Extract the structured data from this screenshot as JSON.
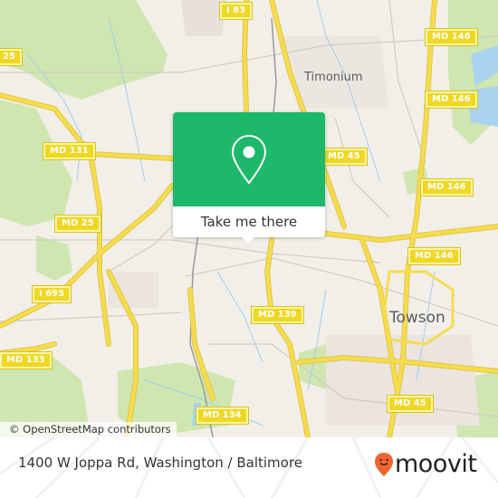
{
  "map": {
    "colors": {
      "land": "#f2efe9",
      "park": "#cfe6b0",
      "residential": "#e7e0db",
      "water": "#a9d3ee",
      "highway": "#f5dc4e",
      "highway_casing": "#e2c744",
      "minor_road": "#cfcac4",
      "rail": "#9a9a9a"
    },
    "shields": [
      {
        "label": "I 83"
      },
      {
        "label": "MD 146"
      },
      {
        "label": "MD 146"
      },
      {
        "label": "MD 131"
      },
      {
        "label": "MD 45"
      },
      {
        "label": "MD 146"
      },
      {
        "label": "MD 25"
      },
      {
        "label": "MD 146"
      },
      {
        "label": "I 695"
      },
      {
        "label": "MD 139"
      },
      {
        "label": "MD 133"
      },
      {
        "label": "MD 45"
      },
      {
        "label": "MD 134"
      },
      {
        "label": "25"
      }
    ],
    "places": [
      {
        "label": "Timonium"
      },
      {
        "label": "Towson"
      }
    ],
    "attribution": "© OpenStreetMap contributors"
  },
  "popup": {
    "icon": "map-pin-icon",
    "button_label": "Take me there",
    "accent": "#1db86a"
  },
  "footer": {
    "address": "1400 W Joppa Rd, Washington / Baltimore",
    "brand": "moovit",
    "brand_icon": "moovit-pin-icon",
    "brand_color": "#f0642f"
  }
}
